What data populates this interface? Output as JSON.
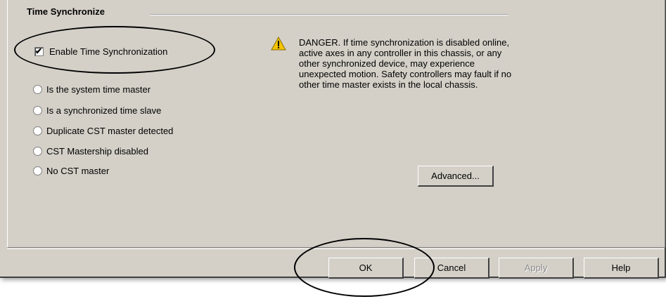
{
  "group": {
    "title": "Time Synchronize"
  },
  "checkbox": {
    "label": "Enable Time Synchronization",
    "checked": true,
    "mark": "✔"
  },
  "radios": [
    {
      "label": "Is the system time master"
    },
    {
      "label": "Is a synchronized time slave"
    },
    {
      "label": "Duplicate CST master detected"
    },
    {
      "label": "CST Mastership disabled"
    },
    {
      "label": "No CST master"
    }
  ],
  "warning": {
    "icon": "warning-triangle-icon",
    "text": "DANGER. If time synchronization is disabled online, active axes in any controller in this chassis, or any other synchronized device, may experience unexpected motion.  Safety controllers may fault if no other time master exists in the local chassis."
  },
  "buttons": {
    "advanced": "Advanced...",
    "ok": "OK",
    "cancel": "Cancel",
    "apply": "Apply",
    "help": "Help"
  },
  "colors": {
    "face": "#d4d0c8",
    "icon_yellow": "#f5c400"
  }
}
